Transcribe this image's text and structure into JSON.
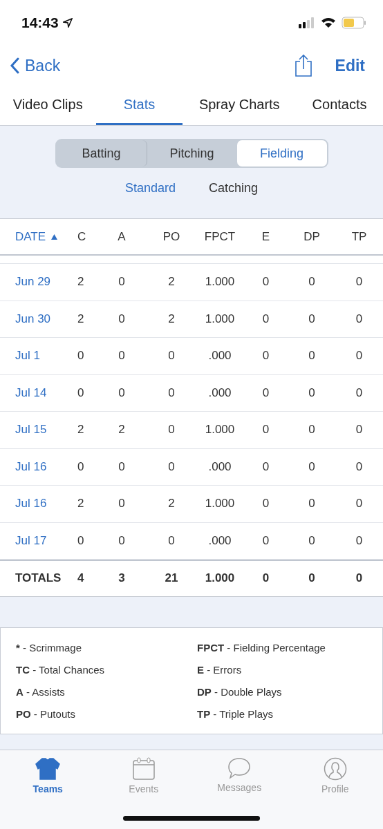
{
  "status_bar": {
    "time": "14:43"
  },
  "nav": {
    "back": "Back",
    "edit": "Edit"
  },
  "tabs": [
    {
      "label": "Video Clips",
      "selected": false
    },
    {
      "label": "Stats",
      "selected": true
    },
    {
      "label": "Spray Charts",
      "selected": false
    },
    {
      "label": "Contacts",
      "selected": false
    }
  ],
  "segments": [
    {
      "label": "Batting",
      "selected": false
    },
    {
      "label": "Pitching",
      "selected": false
    },
    {
      "label": "Fielding",
      "selected": true
    }
  ],
  "sub_tabs": [
    {
      "label": "Standard",
      "selected": true
    },
    {
      "label": "Catching",
      "selected": false
    }
  ],
  "table": {
    "columns": [
      {
        "label": "DATE",
        "sorted": true
      },
      {
        "label": "C",
        "sorted": false
      },
      {
        "label": "A",
        "sorted": false
      },
      {
        "label": "PO",
        "sorted": false
      },
      {
        "label": "FPCT",
        "sorted": false
      },
      {
        "label": "E",
        "sorted": false
      },
      {
        "label": "DP",
        "sorted": false
      },
      {
        "label": "TP",
        "sorted": false
      }
    ],
    "rows": [
      [
        "Jun 29",
        "2",
        "0",
        "2",
        "1.000",
        "0",
        "0",
        "0"
      ],
      [
        "Jun 30",
        "2",
        "0",
        "2",
        "1.000",
        "0",
        "0",
        "0"
      ],
      [
        "Jul 1",
        "0",
        "0",
        "0",
        ".000",
        "0",
        "0",
        "0"
      ],
      [
        "Jul 14",
        "0",
        "0",
        "0",
        ".000",
        "0",
        "0",
        "0"
      ],
      [
        "Jul 15",
        "2",
        "2",
        "0",
        "1.000",
        "0",
        "0",
        "0"
      ],
      [
        "Jul 16",
        "0",
        "0",
        "0",
        ".000",
        "0",
        "0",
        "0"
      ],
      [
        "Jul 16",
        "2",
        "0",
        "2",
        "1.000",
        "0",
        "0",
        "0"
      ],
      [
        "Jul 17",
        "0",
        "0",
        "0",
        ".000",
        "0",
        "0",
        "0"
      ]
    ],
    "totals": [
      "TOTALS",
      "4",
      "3",
      "21",
      "1.000",
      "0",
      "0",
      "0"
    ]
  },
  "legend": [
    {
      "abbr": "*",
      "text": "- Scrimmage"
    },
    {
      "abbr": "FPCT",
      "text": "- Fielding Percentage"
    },
    {
      "abbr": "TC",
      "text": "- Total Chances"
    },
    {
      "abbr": "E",
      "text": "- Errors"
    },
    {
      "abbr": "A",
      "text": "- Assists"
    },
    {
      "abbr": "DP",
      "text": "- Double Plays"
    },
    {
      "abbr": "PO",
      "text": "- Putouts"
    },
    {
      "abbr": "TP",
      "text": "- Triple Plays"
    }
  ],
  "tab_bar": [
    {
      "kind": "teams",
      "label": "Teams",
      "selected": true
    },
    {
      "kind": "events",
      "label": "Events",
      "selected": false
    },
    {
      "kind": "messages",
      "label": "Messages",
      "selected": false
    },
    {
      "kind": "profile",
      "label": "Profile",
      "selected": false
    }
  ]
}
